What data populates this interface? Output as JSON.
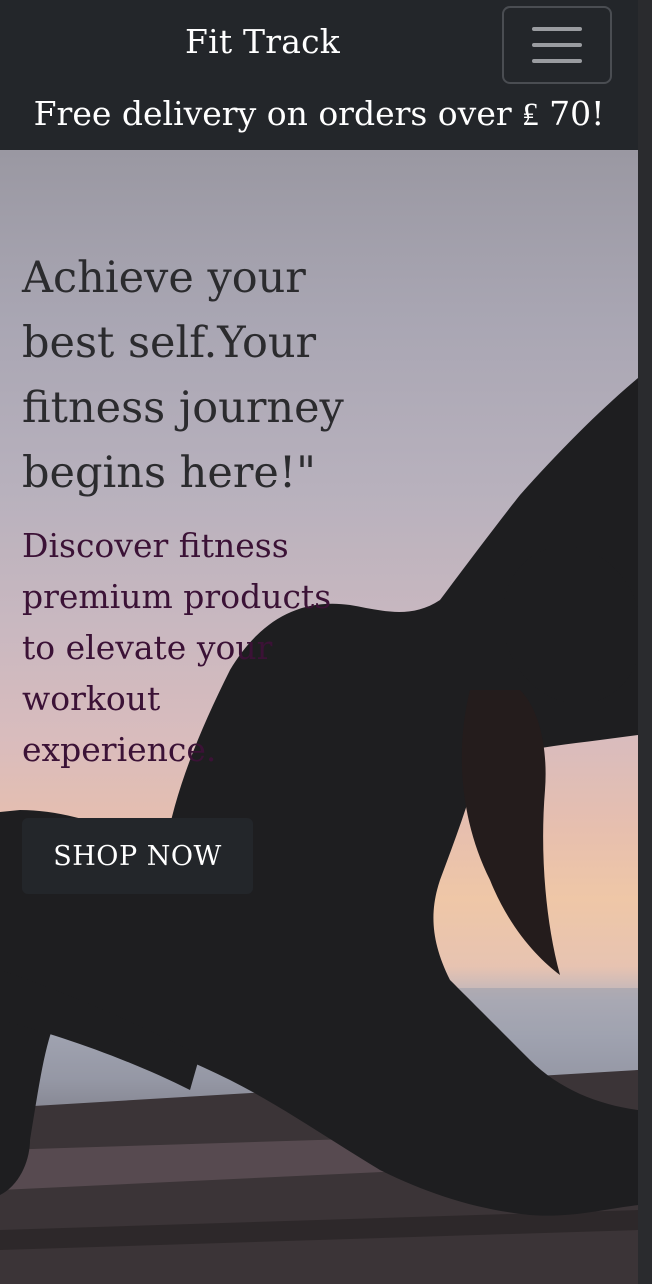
{
  "navbar": {
    "brand": "Fit Track",
    "toggler_icon": "hamburger-menu-icon",
    "promo_text": "Free delivery on orders over ₤ 70!"
  },
  "hero": {
    "headline": "Achieve your best self.Your fitness journey begins here!\"",
    "subline": "Discover fitness premium products to elevate your workout experience.",
    "cta_label": "SHOP NOW",
    "image_subject": "yoga-silhouette-at-sunset"
  },
  "colors": {
    "navbar_bg": "#23262a",
    "headline": "#2b2b2e",
    "subline": "#3b1236",
    "button_bg": "#23262a"
  }
}
